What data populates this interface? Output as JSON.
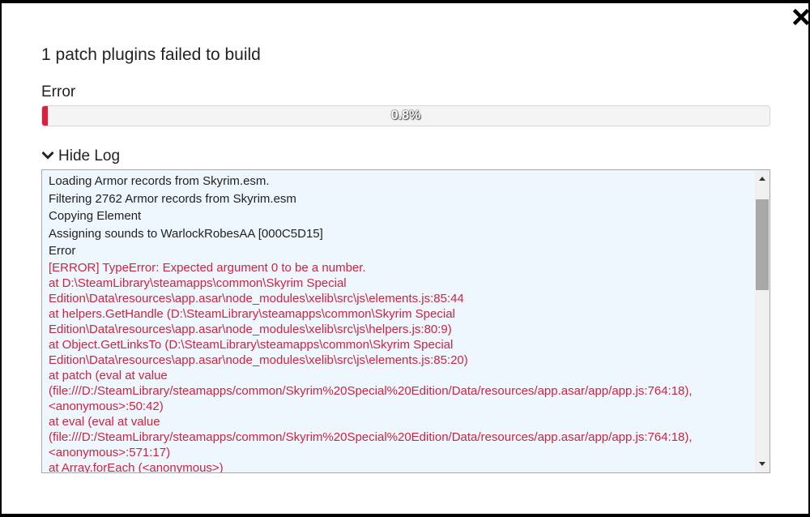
{
  "dialog": {
    "title": "1 patch plugins failed to build",
    "status_label": "Error"
  },
  "progress": {
    "percent": 0.8,
    "label": "0.8%",
    "fill_color": "#dc1f3e"
  },
  "log_toggle": {
    "label": "Hide Log",
    "icon": "chevron-down-icon"
  },
  "log": {
    "lines": [
      {
        "text": "Loading Armor records from Skyrim.esm.",
        "type": "info"
      },
      {
        "text": "Filtering 2762 Armor records from Skyrim.esm",
        "type": "info"
      },
      {
        "text": "Copying Element",
        "type": "info"
      },
      {
        "text": "Assigning sounds to WarlockRobesAA [000C5D15]",
        "type": "info"
      },
      {
        "text": "Error",
        "type": "info"
      },
      {
        "text": "[ERROR] TypeError: Expected argument 0 to be a number.",
        "type": "err"
      },
      {
        "text": "    at D:\\SteamLibrary\\steamapps\\common\\Skyrim Special",
        "type": "err"
      },
      {
        "text": "Edition\\Data\\resources\\app.asar\\node_modules\\xelib\\src\\js\\elements.js:85:44",
        "type": "err"
      },
      {
        "text": "    at helpers.GetHandle (D:\\SteamLibrary\\steamapps\\common\\Skyrim Special",
        "type": "err"
      },
      {
        "text": "Edition\\Data\\resources\\app.asar\\node_modules\\xelib\\src\\js\\helpers.js:80:9)",
        "type": "err"
      },
      {
        "text": "    at Object.GetLinksTo (D:\\SteamLibrary\\steamapps\\common\\Skyrim Special",
        "type": "err"
      },
      {
        "text": "Edition\\Data\\resources\\app.asar\\node_modules\\xelib\\src\\js\\elements.js:85:20)",
        "type": "err"
      },
      {
        "text": "    at patch (eval at value",
        "type": "err"
      },
      {
        "text": "(file:///D:/SteamLibrary/steamapps/common/Skyrim%20Special%20Edition/Data/resources/app.asar/app/app.js:764:18),",
        "type": "err"
      },
      {
        "text": "<anonymous>:50:42)",
        "type": "err"
      },
      {
        "text": "    at eval (eval at value",
        "type": "err"
      },
      {
        "text": "(file:///D:/SteamLibrary/steamapps/common/Skyrim%20Special%20Edition/Data/resources/app.asar/app/app.js:764:18),",
        "type": "err"
      },
      {
        "text": "<anonymous>:571:17)",
        "type": "err"
      },
      {
        "text": "    at Array.forEach (<anonymous>)",
        "type": "err"
      }
    ]
  }
}
